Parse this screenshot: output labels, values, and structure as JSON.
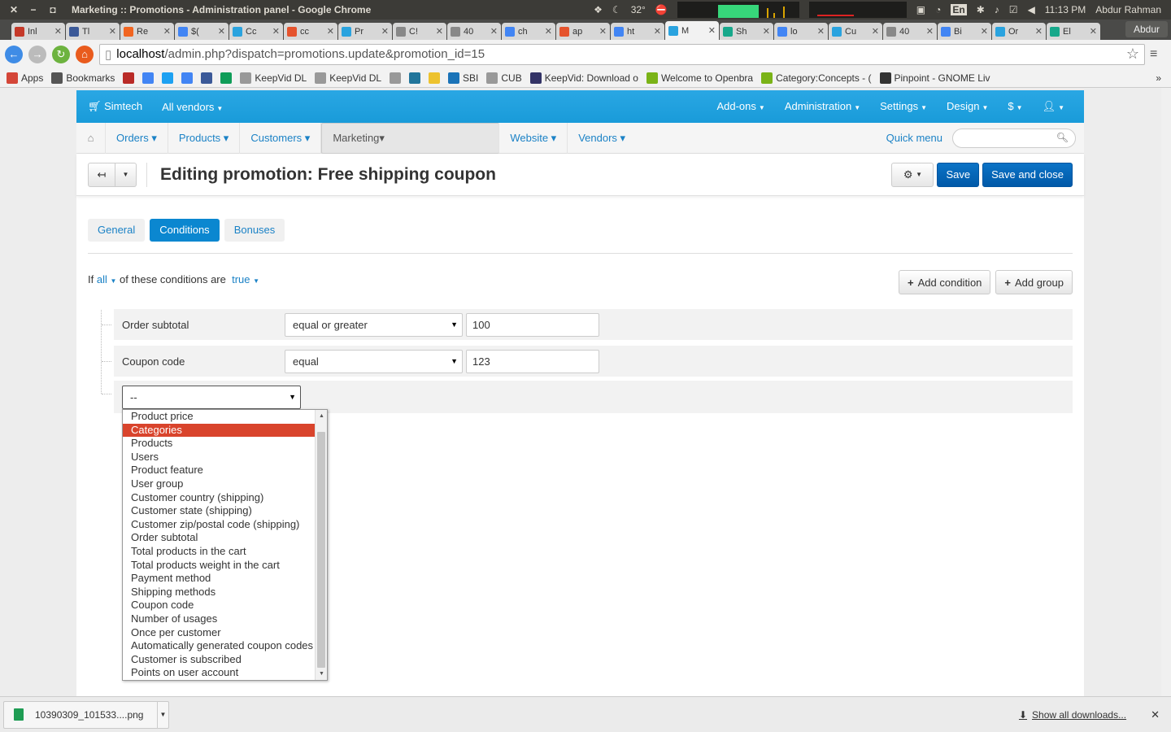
{
  "os": {
    "window_title": "Marketing :: Promotions - Administration panel - Google Chrome",
    "temperature": "32°",
    "language": "En",
    "time": "11:13 PM",
    "user": "Abdur Rahman"
  },
  "browser": {
    "tabs": [
      {
        "label": "Inl",
        "icon": "gmail-icon",
        "color": "#c53929"
      },
      {
        "label": "Tl",
        "icon": "facebook-icon",
        "color": "#3b5998"
      },
      {
        "label": "Re",
        "icon": "etsy-icon",
        "color": "#f16521"
      },
      {
        "label": "$(",
        "icon": "google-icon",
        "color": "#4285f4"
      },
      {
        "label": "Cc",
        "icon": "cscart-icon",
        "color": "#2aa3df"
      },
      {
        "label": "cc",
        "icon": "ask-icon",
        "color": "#e5532d"
      },
      {
        "label": "Pr",
        "icon": "gear-icon",
        "color": "#2aa3df"
      },
      {
        "label": "C!",
        "icon": "page-icon",
        "color": "#888888"
      },
      {
        "label": "40",
        "icon": "page-icon",
        "color": "#888888"
      },
      {
        "label": "ch",
        "icon": "google-icon",
        "color": "#4285f4"
      },
      {
        "label": "ap",
        "icon": "ask-icon",
        "color": "#e5532d"
      },
      {
        "label": "ht",
        "icon": "google-icon",
        "color": "#4285f4"
      },
      {
        "label": "M",
        "icon": "gear-icon",
        "color": "#2aa3df",
        "active": true
      },
      {
        "label": "Sh",
        "icon": "grid-icon",
        "color": "#17a88b"
      },
      {
        "label": "lo",
        "icon": "google-icon",
        "color": "#4285f4"
      },
      {
        "label": "Cu",
        "icon": "cscart-icon",
        "color": "#2aa3df"
      },
      {
        "label": "40",
        "icon": "page-icon",
        "color": "#888888"
      },
      {
        "label": "Bi",
        "icon": "google-icon",
        "color": "#4285f4"
      },
      {
        "label": "Or",
        "icon": "cscart-icon",
        "color": "#2aa3df"
      },
      {
        "label": "El",
        "icon": "grid-icon",
        "color": "#17a88b"
      }
    ],
    "profile": "Abdur",
    "url_host": "localhost",
    "url_path": "/admin.php?dispatch=promotions.update&promotion_id=15",
    "bookmarks": [
      {
        "label": "Apps",
        "icon": "apps-icon",
        "color": "#d44638"
      },
      {
        "label": "Bookmarks",
        "icon": "star-icon",
        "color": "#555555"
      },
      {
        "label": "",
        "icon": "quora-icon",
        "color": "#b92b27"
      },
      {
        "label": "",
        "icon": "google-icon",
        "color": "#4285f4"
      },
      {
        "label": "",
        "icon": "twitter-icon",
        "color": "#1da1f2"
      },
      {
        "label": "",
        "icon": "google-icon",
        "color": "#4285f4"
      },
      {
        "label": "",
        "icon": "facebook-icon",
        "color": "#3b5998"
      },
      {
        "label": "",
        "icon": "drive-icon",
        "color": "#0f9d58"
      },
      {
        "label": "KeepVid DL",
        "icon": "page-icon",
        "color": "#999999"
      },
      {
        "label": "KeepVid DL",
        "icon": "page-icon",
        "color": "#999999"
      },
      {
        "label": "",
        "icon": "page-icon",
        "color": "#999999"
      },
      {
        "label": "",
        "icon": "wordpress-icon",
        "color": "#21759b"
      },
      {
        "label": "",
        "icon": "game-icon",
        "color": "#edc22e"
      },
      {
        "label": "SBI",
        "icon": "sbi-icon",
        "color": "#1a73b8"
      },
      {
        "label": "CUB",
        "icon": "page-icon",
        "color": "#999999"
      },
      {
        "label": "KeepVid: Download o",
        "icon": "keepvid-icon",
        "color": "#333366"
      },
      {
        "label": "Welcome to Openbra",
        "icon": "openbravo-icon",
        "color": "#7ab317"
      },
      {
        "label": "Category:Concepts - (",
        "icon": "openbravo-icon",
        "color": "#7ab317"
      },
      {
        "label": "Pinpoint - GNOME Liv",
        "icon": "gnome-icon",
        "color": "#333333"
      }
    ]
  },
  "app": {
    "brand": "Simtech",
    "vendors": "All vendors",
    "top_menu": [
      "Add-ons",
      "Administration",
      "Settings",
      "Design",
      "$"
    ],
    "main_menu": [
      "Orders",
      "Products",
      "Customers",
      "Marketing",
      "Website",
      "Vendors"
    ],
    "quick_menu": "Quick menu",
    "page_title": "Editing promotion: Free shipping coupon",
    "save": "Save",
    "save_close": "Save and close",
    "tabs": [
      "General",
      "Conditions",
      "Bonuses"
    ],
    "active_tab": "Conditions",
    "cond_if": "If",
    "cond_all": "all",
    "cond_mid": "of these conditions are",
    "cond_true": "true",
    "add_condition": "Add condition",
    "add_group": "Add group",
    "conditions": [
      {
        "label": "Order subtotal",
        "operator": "equal or greater",
        "value": "100"
      },
      {
        "label": "Coupon code",
        "operator": "equal",
        "value": "123"
      }
    ],
    "new_condition_value": "--",
    "dropdown_options": [
      "Product price",
      "Categories",
      "Products",
      "Users",
      "Product feature",
      "User group",
      "Customer country (shipping)",
      "Customer state (shipping)",
      "Customer zip/postal code (shipping)",
      "Order subtotal",
      "Total products in the cart",
      "Total products weight in the cart",
      "Payment method",
      "Shipping methods",
      "Coupon code",
      "Number of usages",
      "Once per customer",
      "Automatically generated coupon codes",
      "Customer is subscribed",
      "Points on user account"
    ],
    "highlighted_option": "Categories",
    "accent": "#2aa3df",
    "highlight_color": "#d9442c"
  },
  "downloads": {
    "file": "10390309_101533....png",
    "show_all": "Show all downloads..."
  }
}
